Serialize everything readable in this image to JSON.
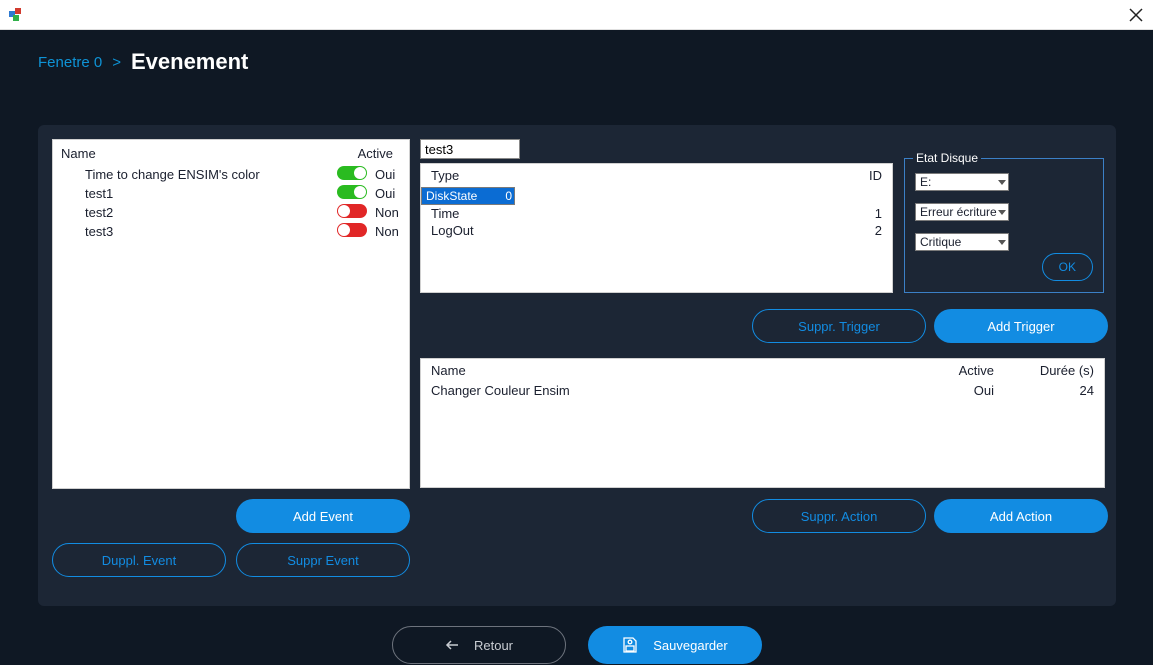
{
  "breadcrumb": {
    "parent": "Fenetre 0",
    "sep": ">",
    "title": "Evenement"
  },
  "eventlist": {
    "header_name": "Name",
    "header_active": "Active",
    "on_label": "Oui",
    "off_label": "Non",
    "rows": [
      {
        "name": "Time to change ENSIM's color",
        "active": true
      },
      {
        "name": "test1",
        "active": true
      },
      {
        "name": "test2",
        "active": false
      },
      {
        "name": "test3",
        "active": false
      }
    ]
  },
  "selected_event_name": "test3",
  "triggerlist": {
    "header_type": "Type",
    "header_id": "ID",
    "rows": [
      {
        "type": "DiskState",
        "id": 0,
        "selected": true
      },
      {
        "type": "Time",
        "id": 1,
        "selected": false
      },
      {
        "type": "LogOut",
        "id": 2,
        "selected": false
      }
    ]
  },
  "etat_disque": {
    "legend": "Etat Disque",
    "drive": "E:",
    "error": "Erreur écriture",
    "severity": "Critique",
    "ok_label": "OK"
  },
  "actionlist": {
    "header_name": "Name",
    "header_active": "Active",
    "header_duree": "Durée (s)",
    "rows": [
      {
        "name": "Changer Couleur Ensim",
        "active": "Oui",
        "duree": 24
      }
    ]
  },
  "buttons": {
    "add_event": "Add Event",
    "duppl_event": "Duppl. Event",
    "suppr_event": "Suppr Event",
    "suppr_trigger": "Suppr. Trigger",
    "add_trigger": "Add Trigger",
    "suppr_action": "Suppr. Action",
    "add_action": "Add Action",
    "retour": "Retour",
    "sauvegarder": "Sauvegarder"
  }
}
